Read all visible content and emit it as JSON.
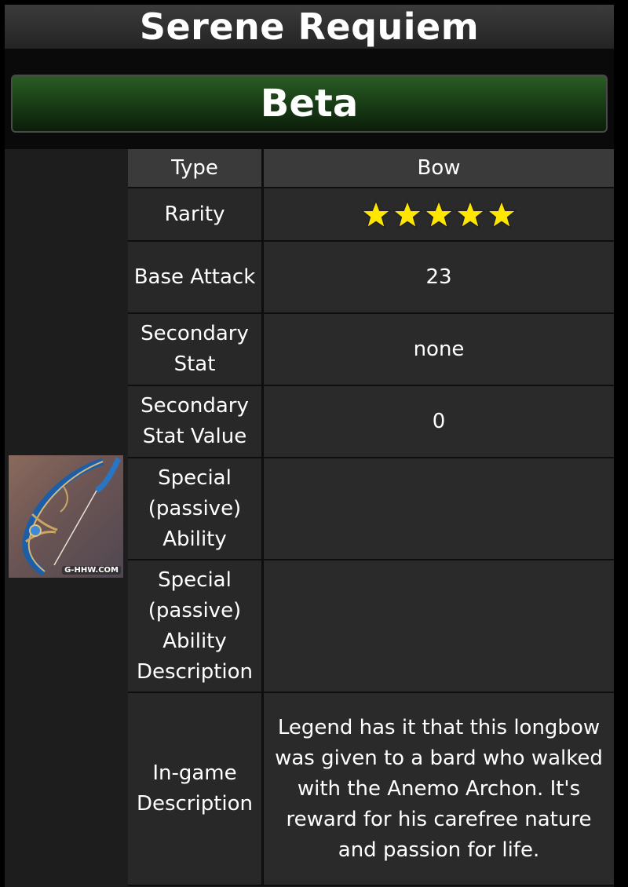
{
  "page": {
    "title": "Serene Requiem"
  },
  "banner": {
    "label": "Beta"
  },
  "image": {
    "watermark": "G-HHW.COM",
    "name": "weapon-bow-image"
  },
  "rows": [
    {
      "label": "Type",
      "value": "Bow"
    },
    {
      "label": "Rarity",
      "value": 5,
      "stars_icon": "star-icon"
    },
    {
      "label": "Base Attack",
      "value": "23"
    },
    {
      "label": "Secondary Stat",
      "value": "none"
    },
    {
      "label": "Secondary Stat Value",
      "value": "0"
    },
    {
      "label": "Special (passive) Ability",
      "value": ""
    },
    {
      "label": "Special (passive) Ability Description",
      "value": ""
    },
    {
      "label": "In-game Description",
      "value": "Legend has it that this longbow was given to a bard who walked with the Anemo Archon. It's reward for his carefree nature and passion for life."
    }
  ],
  "colors": {
    "accent_gold": "#e2b53c",
    "star_yellow": "#ffe600",
    "banner_green": "#2a5c24"
  }
}
